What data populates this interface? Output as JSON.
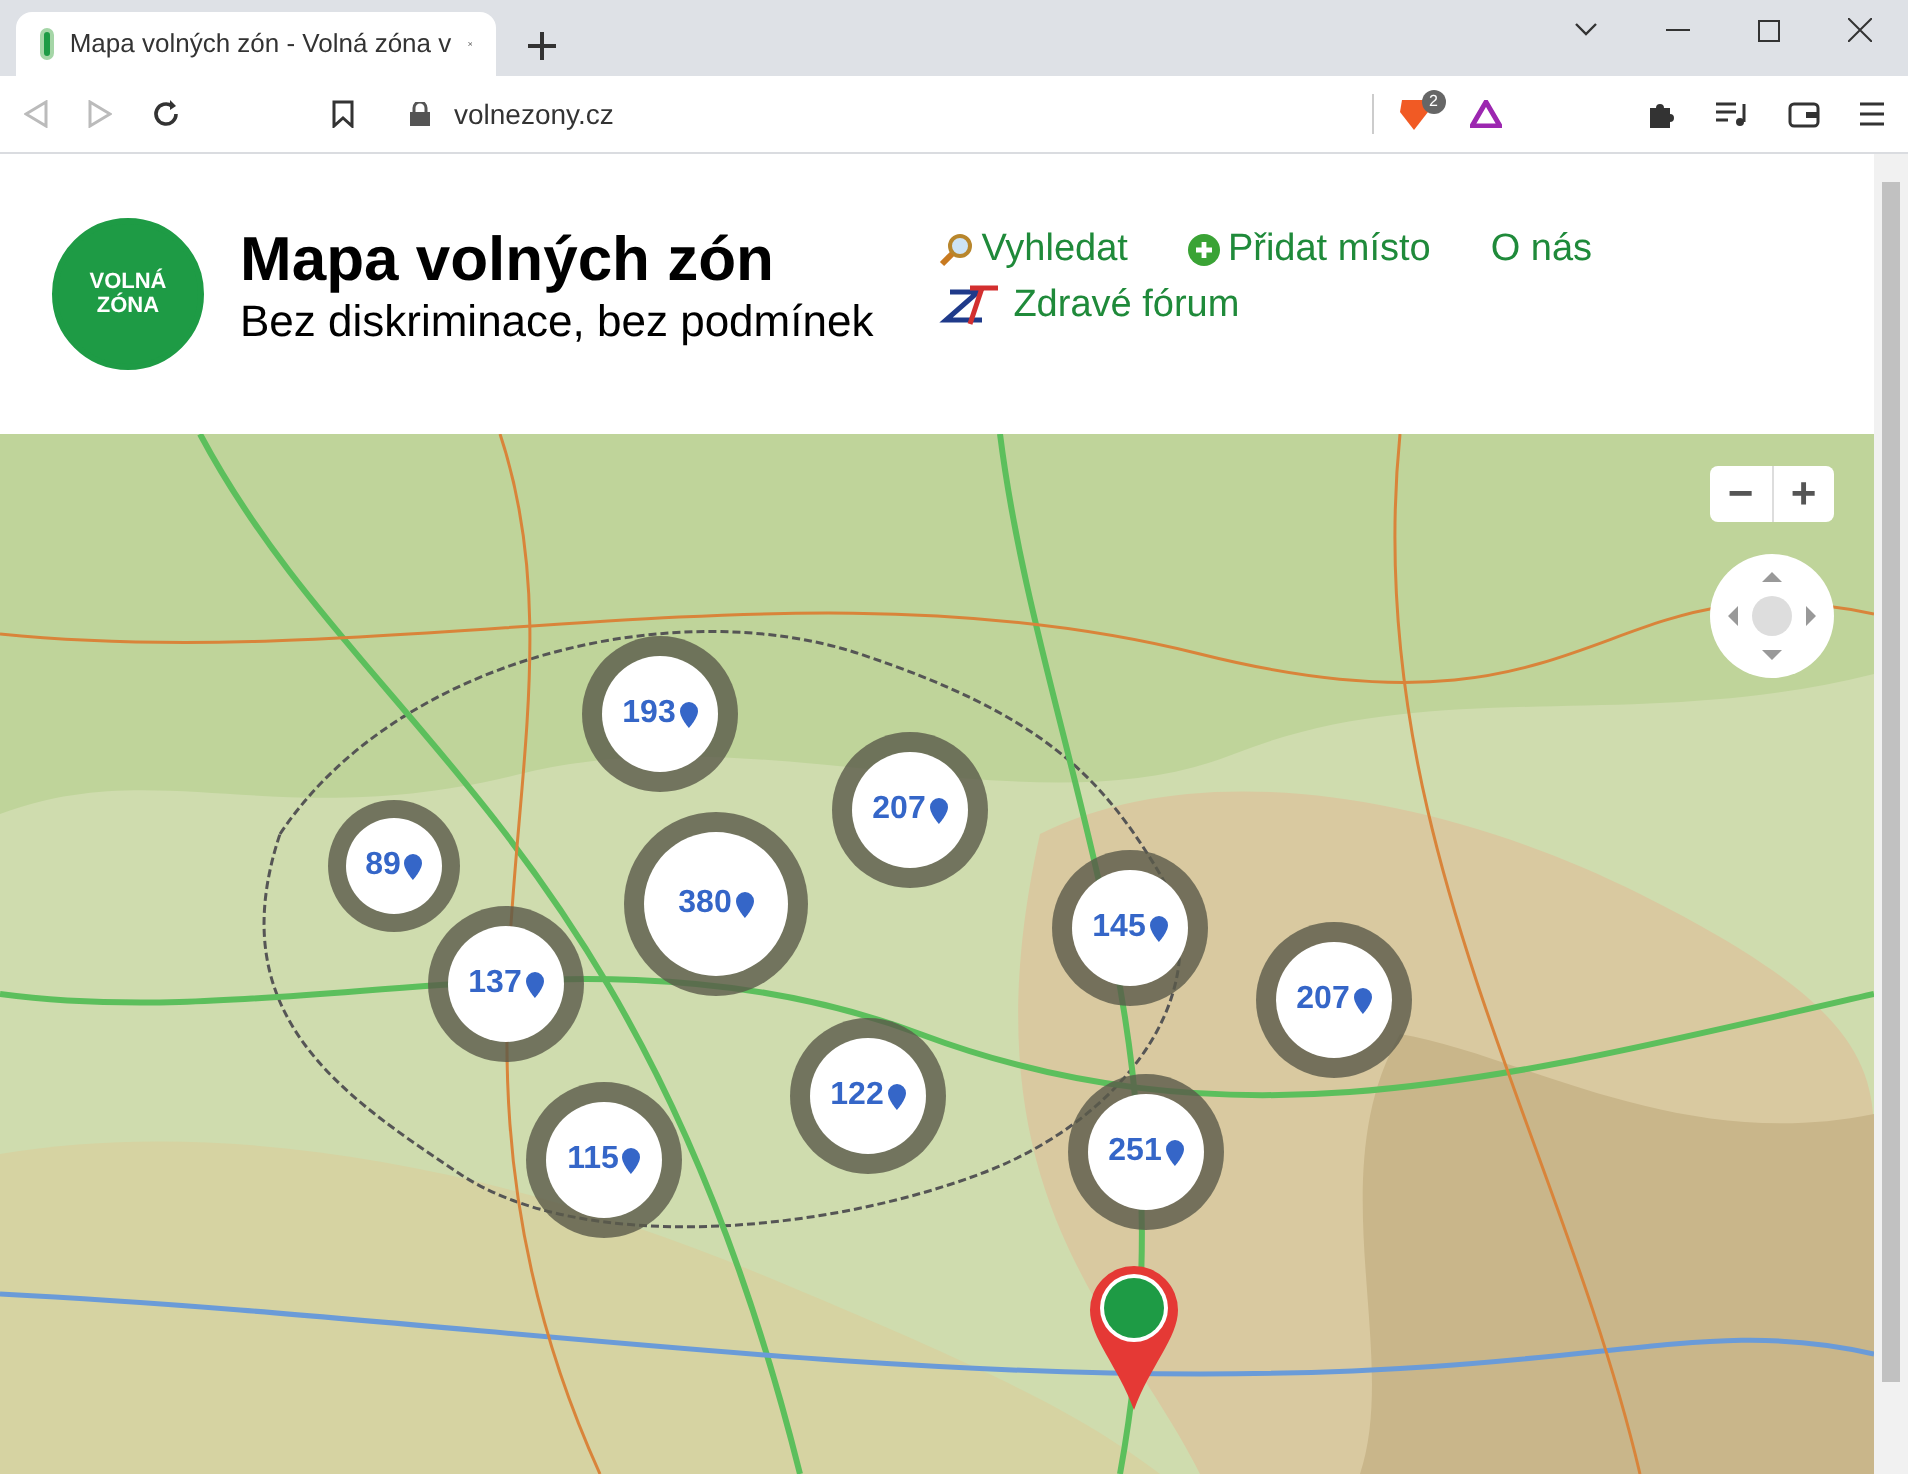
{
  "browser": {
    "tab_title": "Mapa volných zón - Volná zóna v",
    "url": "volnezony.cz",
    "shield_count": "2"
  },
  "site": {
    "logo": [
      "VOLNÁ",
      "ZÓNA"
    ],
    "title": "Mapa volných zón",
    "subtitle": "Bez diskriminace, bez podmínek",
    "nav": [
      {
        "kind": "search",
        "label": "Vyhledat"
      },
      {
        "kind": "add",
        "label": "Přidat místo"
      },
      {
        "kind": "plain",
        "label": "O nás"
      },
      {
        "kind": "forum",
        "label": "Zdravé fórum"
      }
    ]
  },
  "map": {
    "zoom": [
      "−",
      "+"
    ],
    "clusters": [
      {
        "count": "193"
      },
      {
        "count": "207"
      },
      {
        "count": "89"
      },
      {
        "count": "380"
      },
      {
        "count": "145"
      },
      {
        "count": "137"
      },
      {
        "count": "207"
      },
      {
        "count": "122"
      },
      {
        "count": "115"
      },
      {
        "count": "251"
      }
    ]
  }
}
